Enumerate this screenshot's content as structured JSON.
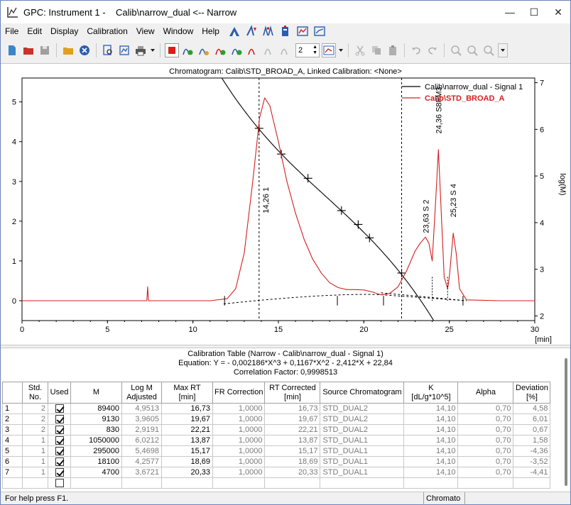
{
  "window": {
    "title": "GPC: Instrument 1 -    Calib\\narrow_dual <-- Narrow",
    "minimize": "—",
    "maximize": "☐",
    "close": "✕"
  },
  "menu": [
    "File",
    "Edit",
    "Display",
    "Calibration",
    "View",
    "Window",
    "Help"
  ],
  "toolbar": {
    "spin_value": "2"
  },
  "chart_data": {
    "type": "line",
    "title": "Chromatogram: Calib\\STD_BROAD_A, Linked Calibration: <None>",
    "xlabel": "[min]",
    "ylabel_right": "log(M)",
    "xlim": [
      0,
      30
    ],
    "ylim_left": [
      -0.5,
      5.6
    ],
    "ylim_right": [
      1.9,
      7.1
    ],
    "x_ticks": [
      "0",
      "5",
      "10",
      "15",
      "20",
      "25",
      "30"
    ],
    "y_ticks_left": [
      "0",
      "1",
      "2",
      "3",
      "4",
      "5"
    ],
    "y_ticks_right": [
      "2",
      "3",
      "4",
      "5",
      "6",
      "7"
    ],
    "legend": {
      "position": "top-right",
      "entries": [
        "Calib\\narrow_dual - Signal 1",
        "Calib\\STD_BROAD_A"
      ]
    },
    "series_colors": {
      "calibration": "#000000",
      "chromatogram": "#d42020"
    },
    "calibration_points": [
      {
        "x": 13.87,
        "logM": 6.0212
      },
      {
        "x": 15.17,
        "logM": 5.4698
      },
      {
        "x": 16.73,
        "logM": 4.9513
      },
      {
        "x": 18.69,
        "logM": 4.2577
      },
      {
        "x": 19.67,
        "logM": 3.9605
      },
      {
        "x": 20.33,
        "logM": 3.6721
      },
      {
        "x": 22.21,
        "logM": 2.9191
      }
    ],
    "chromatogram": [
      [
        0,
        0
      ],
      [
        3,
        0.0
      ],
      [
        7.3,
        0.0
      ],
      [
        7.35,
        0.35
      ],
      [
        7.4,
        0.0
      ],
      [
        11,
        0.0
      ],
      [
        12,
        0.05
      ],
      [
        12.5,
        0.3
      ],
      [
        13,
        1.2
      ],
      [
        13.5,
        3.0
      ],
      [
        13.9,
        4.6
      ],
      [
        14.2,
        5.1
      ],
      [
        14.5,
        4.9
      ],
      [
        15,
        4.0
      ],
      [
        15.5,
        3.0
      ],
      [
        16,
        2.2
      ],
      [
        16.5,
        1.55
      ],
      [
        17,
        1.05
      ],
      [
        17.5,
        0.7
      ],
      [
        18,
        0.45
      ],
      [
        18.5,
        0.33
      ],
      [
        19,
        0.28
      ],
      [
        19.5,
        0.28
      ],
      [
        20,
        0.27
      ],
      [
        20.5,
        0.22
      ],
      [
        21,
        0.15
      ],
      [
        21.5,
        0.18
      ],
      [
        22,
        0.35
      ],
      [
        22.5,
        0.75
      ],
      [
        23,
        1.25
      ],
      [
        23.3,
        1.45
      ],
      [
        23.6,
        1.6
      ],
      [
        23.8,
        1.45
      ],
      [
        24.0,
        1.0
      ],
      [
        24.2,
        2.5
      ],
      [
        24.36,
        3.8
      ],
      [
        24.5,
        2.5
      ],
      [
        24.7,
        0.6
      ],
      [
        24.9,
        0.3
      ],
      [
        25.0,
        0.6
      ],
      [
        25.23,
        1.7
      ],
      [
        25.4,
        1.2
      ],
      [
        25.6,
        0.3
      ],
      [
        26,
        0.02
      ],
      [
        28,
        0.0
      ],
      [
        30,
        0.0
      ]
    ],
    "peak_labels": [
      {
        "x": 14.26,
        "label": "14,26",
        "name": "1"
      },
      {
        "x": 23.63,
        "label": "23,63",
        "name": "S 2"
      },
      {
        "x": 24.36,
        "label": "24,36",
        "name": "S8FM3"
      },
      {
        "x": 25.23,
        "label": "25,23",
        "name": "S 4"
      }
    ]
  },
  "table": {
    "title": "Calibration Table (Narrow - Calib\\narrow_dual - Signal 1)",
    "equation": "Equation: Y =  - 0,002186*X^3 + 0,1167*X^2 - 2,412*X + 22,84",
    "correlation": "Correlation Factor: 0,9998513",
    "headers": [
      "",
      "Std.\nNo.",
      "Used",
      "M",
      "Log M\nAdjusted",
      "Max RT\n[min]",
      "FR Correction",
      "RT Corrected\n[min]",
      "Source Chromatogram",
      "K\n[dL/g*10^5]",
      "Alpha",
      "Deviation\n[%]"
    ],
    "rows": [
      {
        "n": "1",
        "std": "2",
        "used": true,
        "m": "89400",
        "logm": "4,9513",
        "rt": "16,73",
        "fr": "1,0000",
        "rtc": "16,73",
        "src": "STD_DUAL2",
        "k": "14,10",
        "alpha": "0,70",
        "dev": "4,58"
      },
      {
        "n": "2",
        "std": "2",
        "used": true,
        "m": "9130",
        "logm": "3,9605",
        "rt": "19,67",
        "fr": "1,0000",
        "rtc": "19,67",
        "src": "STD_DUAL2",
        "k": "14,10",
        "alpha": "0,70",
        "dev": "6,01"
      },
      {
        "n": "3",
        "std": "2",
        "used": true,
        "m": "830",
        "logm": "2,9191",
        "rt": "22,21",
        "fr": "1,0000",
        "rtc": "22,21",
        "src": "STD_DUAL2",
        "k": "14,10",
        "alpha": "0,70",
        "dev": "0,67"
      },
      {
        "n": "4",
        "std": "1",
        "used": true,
        "m": "1050000",
        "logm": "6,0212",
        "rt": "13,87",
        "fr": "1,0000",
        "rtc": "13,87",
        "src": "STD_DUAL1",
        "k": "14,10",
        "alpha": "0,70",
        "dev": "1,58"
      },
      {
        "n": "5",
        "std": "1",
        "used": true,
        "m": "295000",
        "logm": "5,4698",
        "rt": "15,17",
        "fr": "1,0000",
        "rtc": "15,17",
        "src": "STD_DUAL1",
        "k": "14,10",
        "alpha": "0,70",
        "dev": "-4,36"
      },
      {
        "n": "6",
        "std": "1",
        "used": true,
        "m": "18100",
        "logm": "4,2577",
        "rt": "18,69",
        "fr": "1,0000",
        "rtc": "18,69",
        "src": "STD_DUAL1",
        "k": "14,10",
        "alpha": "0,70",
        "dev": "-3,52"
      },
      {
        "n": "7",
        "std": "1",
        "used": true,
        "m": "4700",
        "logm": "3,6721",
        "rt": "20,33",
        "fr": "1,0000",
        "rtc": "20,33",
        "src": "STD_DUAL1",
        "k": "14,10",
        "alpha": "0,70",
        "dev": "-4,41"
      }
    ]
  },
  "status": {
    "help": "For help press F1.",
    "pane": "Chromato"
  }
}
